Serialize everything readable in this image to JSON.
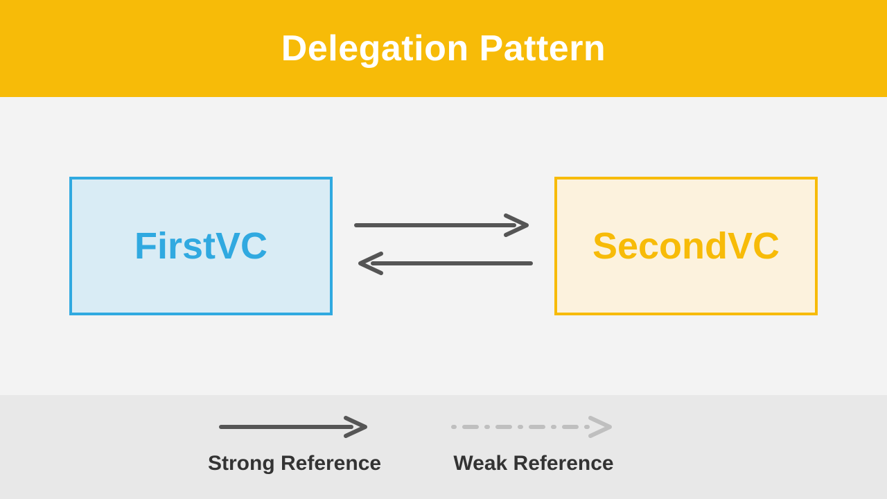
{
  "header": {
    "title": "Delegation Pattern"
  },
  "nodes": {
    "left": {
      "label": "FirstVC"
    },
    "right": {
      "label": "SecondVC"
    }
  },
  "legend": {
    "strong": {
      "label": "Strong Reference"
    },
    "weak": {
      "label": "Weak Reference"
    }
  },
  "colors": {
    "accent_yellow": "#f7bb08",
    "accent_blue": "#30a9e0",
    "arrow_dark": "#555555",
    "arrow_weak": "#bfbfbf"
  }
}
